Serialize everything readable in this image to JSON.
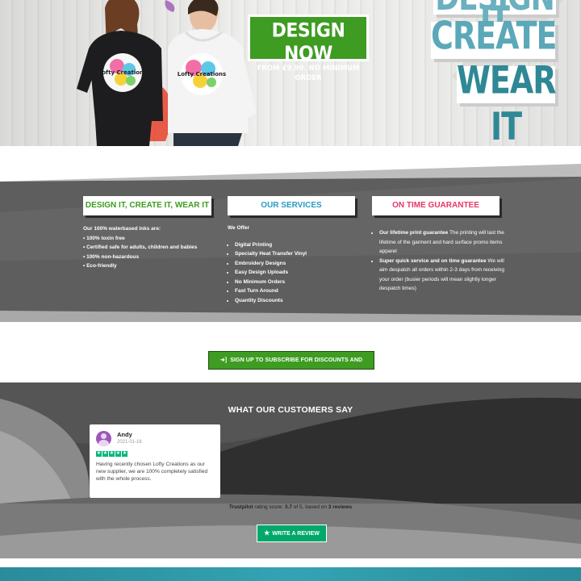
{
  "hero": {
    "design_now_title": "DESIGN NOW",
    "design_now_sub": "FROM £9.99. NO MINIMUM ORDER",
    "slogan_1": "DESIGN IT",
    "slogan_2": "CREATE IT",
    "slogan_3": "WEAR IT",
    "model_print_text": "Lofty Creations"
  },
  "info": {
    "col1": {
      "heading": "DESIGN IT, CREATE IT, WEAR IT",
      "intro": "Our 100% waterbased inks are:",
      "items": [
        "• 100% toxin free",
        "• Certified safe for adults, children and babies",
        "• 100% non-hazardous",
        "• Eco-friendly"
      ]
    },
    "col2": {
      "heading": "OUR SERVICES",
      "intro": "We Offer",
      "items": [
        "Digital Printing",
        "Specialty Heat Transfer Vinyl",
        "Embroidery Designs",
        "Easy Design Uploads",
        "No Minimum Orders",
        "Fast Turn Around",
        "Quantity Discounts"
      ]
    },
    "col3": {
      "heading": "ON TIME GUARANTEE",
      "items": [
        {
          "bold": "Our lifetime print guarantee",
          "text": " The printing will last the lifetime of the garment and hard surface promo items apparel"
        },
        {
          "bold": "Super quick service and on time guarantee",
          "text": " We will aim despatch all orders within 2-3 days from receiving your order (busier periods will mean slightly longer despatch times)"
        }
      ]
    }
  },
  "subscribe": {
    "label": "SIGN UP TO SUBSCRIBE FOR DISCOUNTS AND OFFERS",
    "icon": "sign-in-icon"
  },
  "reviews": {
    "title": "WHAT OUR CUSTOMERS SAY",
    "items": [
      {
        "name": "Andy",
        "date": "2021-01-16",
        "stars": 5,
        "text": "Having recently chosen Lofty Creations as our new supplier, we are 100% completely satisfied with the whole process."
      }
    ],
    "trust_brand": "Trustpilot",
    "trust_text_1": " rating score: ",
    "trust_score": "3.7",
    "trust_text_2": " of 5, based on ",
    "trust_count": "3 reviews",
    "write_review_label": "WRITE A REVIEW"
  },
  "colors": {
    "green": "#3d9c21",
    "teal": "#5ba8b8",
    "blue": "#2a9bc1",
    "pink": "#e8366b",
    "trustpilot": "#00b67a"
  }
}
